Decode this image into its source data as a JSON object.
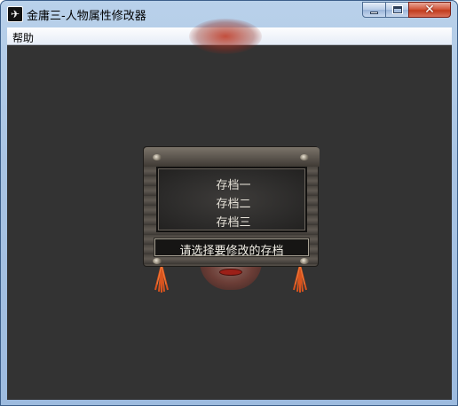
{
  "window": {
    "title": "金庸三-人物属性修改器",
    "icon": "app-icon",
    "controls": {
      "minimize": "minimize-icon",
      "maximize": "maximize-icon",
      "close": "close-icon"
    }
  },
  "menu": {
    "items": [
      {
        "label": "帮助"
      }
    ]
  },
  "saves": {
    "items": [
      {
        "label": "存档一"
      },
      {
        "label": "存档二"
      },
      {
        "label": "存档三"
      }
    ],
    "prompt": "请选择要修改的存档"
  },
  "colors": {
    "client_background": "#333333",
    "titlebar": "#b9d1ea",
    "close_button": "#c23c1d",
    "text_light": "#e6e2d8"
  }
}
